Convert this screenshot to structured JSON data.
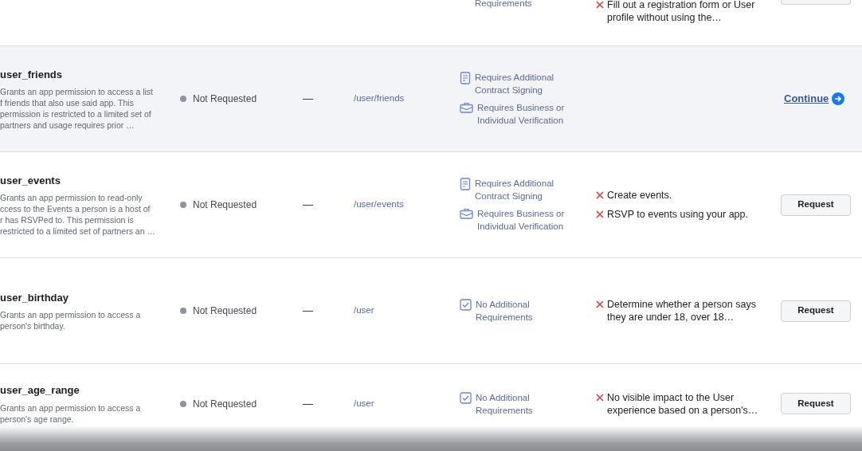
{
  "partial_row": {
    "requirements": [
      {
        "kind": "plain",
        "text": "Requirements"
      }
    ],
    "impacts": [
      "Fill out a registration form or User profile without using the…"
    ]
  },
  "rows": [
    {
      "name": "user_friends",
      "selected": true,
      "description_lines": [
        "Grants an app permission to access a list",
        "f friends that also use said app. This",
        "permission is restricted to a limited set of",
        "partners and usage requires prior …"
      ],
      "status": "Not Requested",
      "dash": "—",
      "endpoint": "/user/friends",
      "requirements": [
        {
          "kind": "contract",
          "text": "Requires Additional Contract Signing"
        },
        {
          "kind": "verification",
          "text": "Requires Business or Individual Verification"
        }
      ],
      "impacts": [],
      "action": {
        "kind": "link",
        "label": "Continue"
      }
    },
    {
      "name": "user_events",
      "selected": false,
      "description_lines": [
        "Grants an app permission to read-only",
        "ccess to the Events a person is a host of",
        "r has RSVPed to. This permission is",
        "restricted to a limited set of partners an …"
      ],
      "status": "Not Requested",
      "dash": "—",
      "endpoint": "/user/events",
      "requirements": [
        {
          "kind": "contract",
          "text": "Requires Additional Contract Signing"
        },
        {
          "kind": "verification",
          "text": "Requires Business or Individual Verification"
        }
      ],
      "impacts": [
        "Create events.",
        "RSVP to events using your app."
      ],
      "action": {
        "kind": "button",
        "label": "Request"
      }
    },
    {
      "name": "user_birthday",
      "selected": false,
      "description_lines": [
        "Grants an app permission to access a",
        "person's birthday."
      ],
      "status": "Not Requested",
      "dash": "—",
      "endpoint": "/user",
      "requirements": [
        {
          "kind": "none",
          "text": "No Additional Requirements"
        }
      ],
      "impacts": [
        "Determine whether a person says they are under 18, over 18…"
      ],
      "action": {
        "kind": "button",
        "label": "Request"
      }
    },
    {
      "name": "user_age_range",
      "selected": false,
      "description_lines": [
        "Grants an app permission to access a",
        "person's age range."
      ],
      "status": "Not Requested",
      "dash": "—",
      "endpoint": "/user",
      "requirements": [
        {
          "kind": "none",
          "text": "No Additional Requirements"
        }
      ],
      "impacts": [
        "No visible impact to the User experience based on a person's…"
      ],
      "action": {
        "kind": "button",
        "label": "Request"
      }
    }
  ]
}
